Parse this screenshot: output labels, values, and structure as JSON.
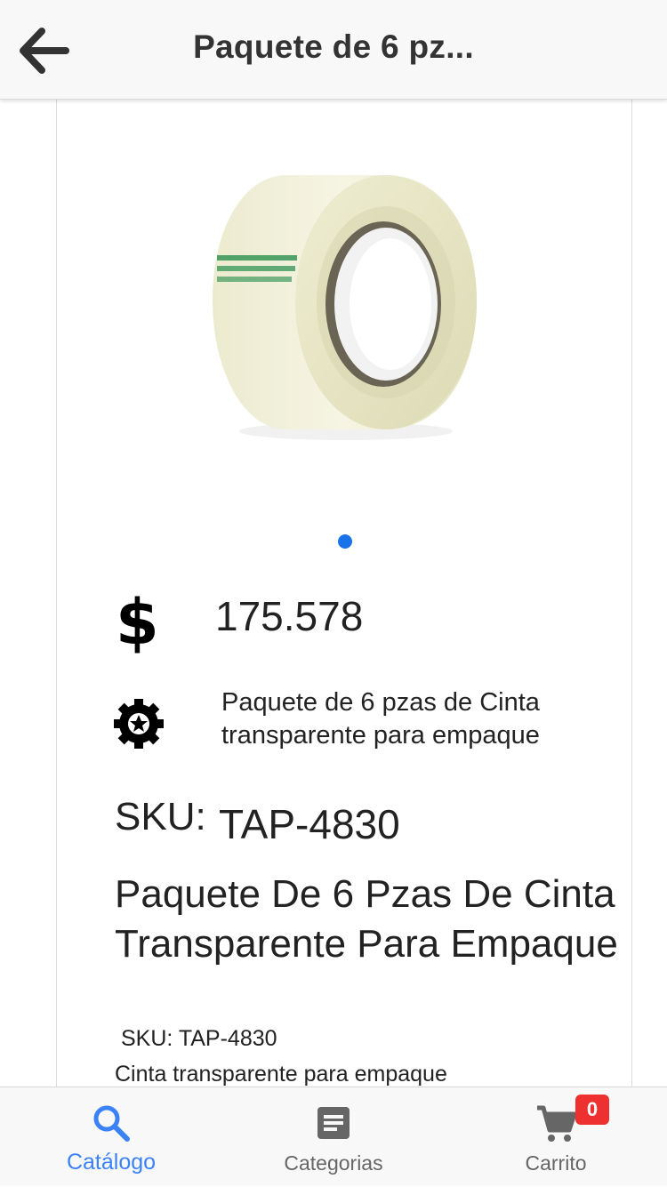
{
  "header": {
    "title": "Paquete de 6 pz...",
    "back_icon": "arrow-left-icon"
  },
  "product": {
    "image_icon": "tape-roll-image",
    "carousel_index": 1,
    "carousel_count": 1,
    "price_symbol": "$",
    "price": "175.578",
    "short_description": "Paquete de 6 pzas de Cinta transparente para empaque",
    "sku_label": "SKU:",
    "sku_value": "TAP-4830",
    "name": "Paquete De 6 Pzas De Cinta Transparente Para Empaque",
    "sku_line": "SKU: TAP-4830",
    "description": "Cinta transparente para empaque"
  },
  "tabs": [
    {
      "label": "Catálogo",
      "icon": "search-icon",
      "active": true
    },
    {
      "label": "Categorias",
      "icon": "document-icon",
      "active": false
    },
    {
      "label": "Carrito",
      "icon": "cart-icon",
      "active": false,
      "badge": "0"
    }
  ],
  "colors": {
    "accent": "#3b82f6",
    "dot": "#1a73e8",
    "badge": "#ee3030"
  }
}
